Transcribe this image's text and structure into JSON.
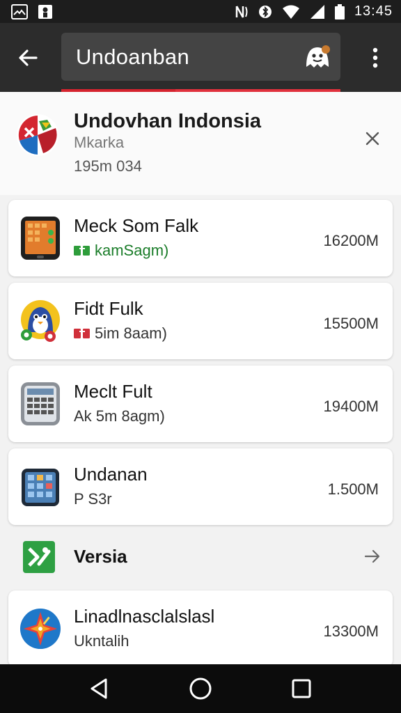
{
  "status_bar": {
    "time": "13:45",
    "left_icons": [
      "image-icon",
      "person-notification-icon"
    ],
    "right_icons": [
      "nfc-icon",
      "bluetooth-icon",
      "wifi-icon",
      "signal-icon",
      "battery-icon"
    ]
  },
  "app_bar": {
    "search_text": "Undoanban",
    "back_icon": "back-arrow-icon",
    "ghost_icon": "ghost-icon",
    "menu_icon": "more-vert-icon",
    "progress": 0.41,
    "accent_color": "#d5232e"
  },
  "header": {
    "title": "Undovhan Indonsia",
    "subtitle": "Mkarka",
    "meta": "195m 034"
  },
  "apps": [
    {
      "name": "Meck Som Falk",
      "sub": "kamSagm)",
      "size": "16200M",
      "badge_color": "#2e9d3b"
    },
    {
      "name": "Fidt Fulk",
      "sub": "5im 8aam)",
      "size": "15500M",
      "badge_color": "#d0303a"
    },
    {
      "name": "Meclt Fult",
      "sub": "Ak 5m 8agm)",
      "size": "19400M"
    },
    {
      "name": "Undanan",
      "sub": "P S3r",
      "size": "1.500M"
    },
    {
      "name": "Linadlnasclalslasl",
      "sub": "Ukntalih",
      "size": "13300M"
    }
  ],
  "section": {
    "label": "Versia"
  },
  "nav_bar": {
    "icons": [
      "nav-back-icon",
      "nav-home-icon",
      "nav-recents-icon"
    ]
  }
}
